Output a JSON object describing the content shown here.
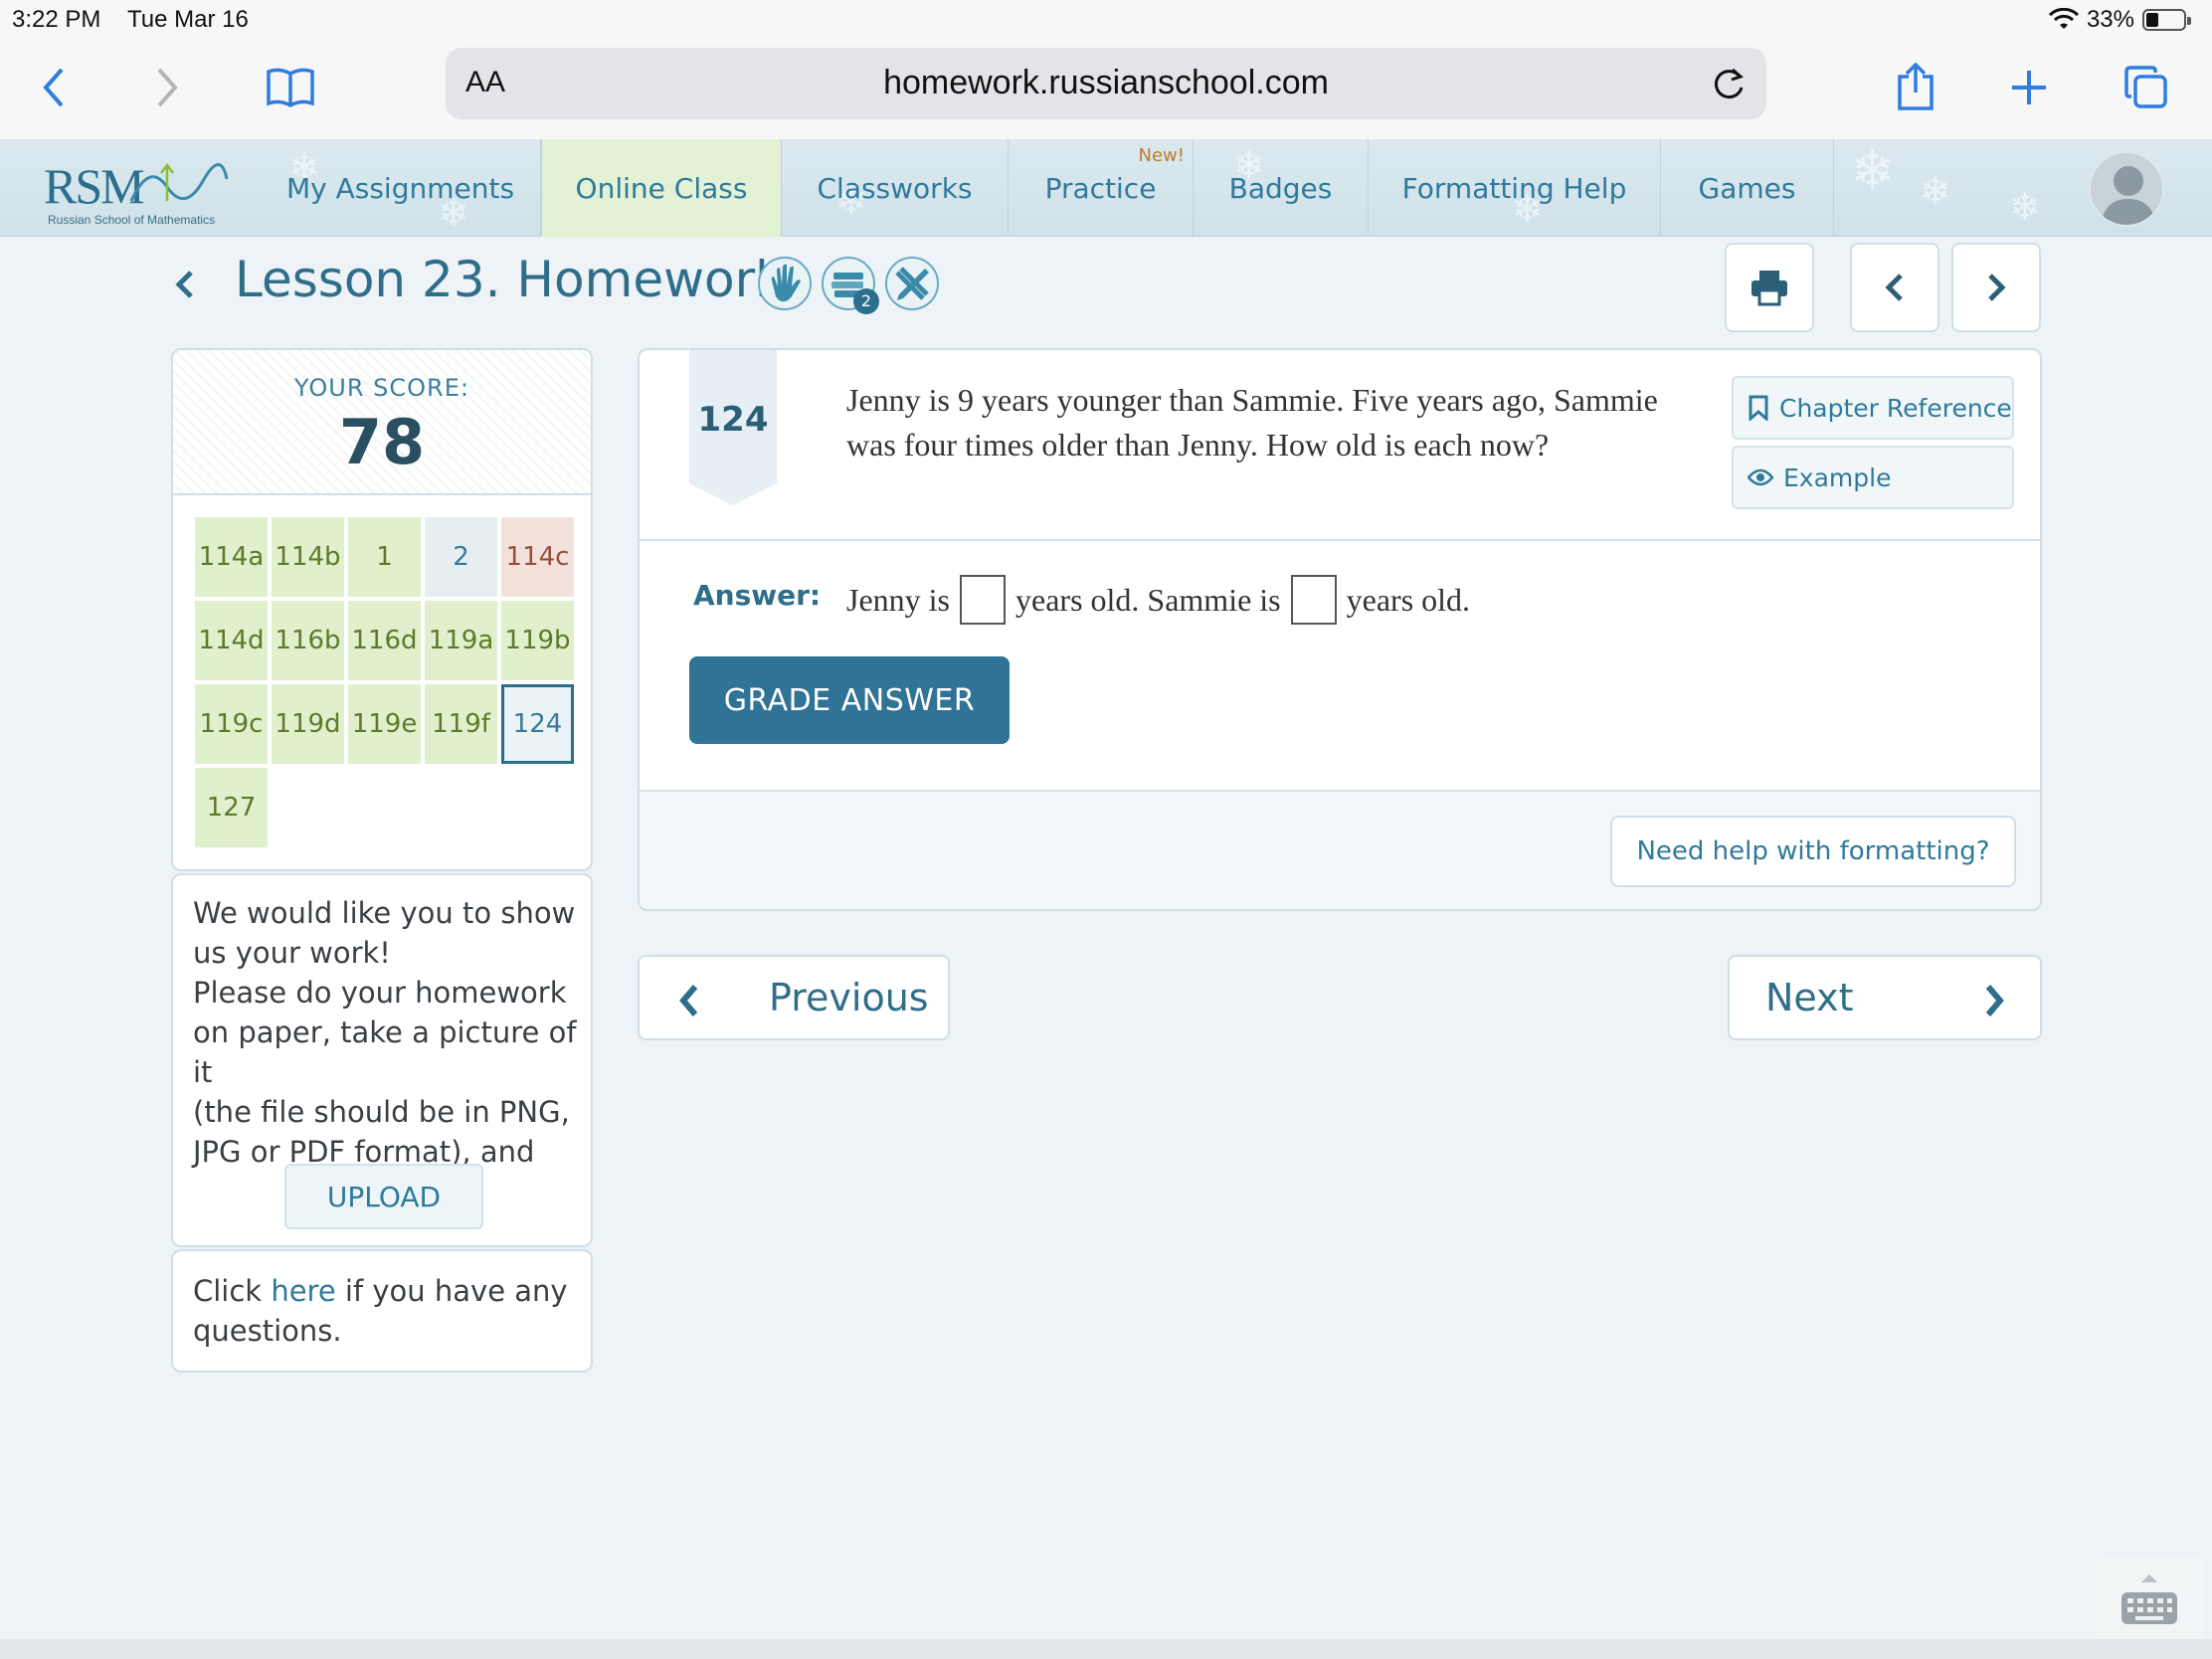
{
  "status_bar": {
    "time": "3:22 PM",
    "date": "Tue Mar 16",
    "battery": "33%",
    "battery_level": 0.33
  },
  "browser": {
    "aa": "AA",
    "url": "homework.russianschool.com"
  },
  "site": {
    "logo_text": "RSM",
    "logo_tagline": "Russian School of Mathematics",
    "nav": [
      {
        "label": "My Assignments"
      },
      {
        "label": "Online Class",
        "active": true
      },
      {
        "label": "Classworks"
      },
      {
        "label": "Practice",
        "badge": "New!"
      },
      {
        "label": "Badges"
      },
      {
        "label": "Formatting Help"
      },
      {
        "label": "Games"
      }
    ],
    "accent": "#2f7396",
    "active_tab_color": "#e3f1d5"
  },
  "header": {
    "title": "Lesson 23. Homework",
    "icon_badge": "2"
  },
  "score": {
    "label": "YOUR SCORE:",
    "value": "78"
  },
  "problems": [
    {
      "label": "114a",
      "status": "done"
    },
    {
      "label": "114b",
      "status": "done"
    },
    {
      "label": "1",
      "status": "done"
    },
    {
      "label": "2",
      "status": "neutral"
    },
    {
      "label": "114c",
      "status": "wrong"
    },
    {
      "label": "114d",
      "status": "done"
    },
    {
      "label": "116b",
      "status": "done"
    },
    {
      "label": "116d",
      "status": "done"
    },
    {
      "label": "119a",
      "status": "done"
    },
    {
      "label": "119b",
      "status": "done"
    },
    {
      "label": "119c",
      "status": "done"
    },
    {
      "label": "119d",
      "status": "done"
    },
    {
      "label": "119e",
      "status": "done"
    },
    {
      "label": "119f",
      "status": "done"
    },
    {
      "label": "124",
      "status": "current"
    },
    {
      "label": "127",
      "status": "done"
    }
  ],
  "upload": {
    "text_lines": [
      "We would like you to show",
      "us your work!",
      "Please do your homework",
      "on paper, take a picture of it",
      "(the file should be in PNG,",
      "JPG or PDF format), and"
    ],
    "button": "UPLOAD"
  },
  "help": {
    "prefix": "Click ",
    "link": "here",
    "suffix": " if you have any questions."
  },
  "problem": {
    "number": "124",
    "text_line1": "Jenny is 9 years younger than Sammie. Five years ago, Sammie",
    "text_line2": "was four times older than Jenny. How old is each now?",
    "chapter_reference": "Chapter Reference",
    "example": "Example",
    "answer_label": "Answer:",
    "answer_part1": "Jenny is",
    "answer_part2": "years old. Sammie is",
    "answer_part3": "years old.",
    "grade_button": "GRADE ANSWER",
    "formatting_help": "Need help with formatting?"
  },
  "pager": {
    "previous": "Previous",
    "next": "Next"
  }
}
